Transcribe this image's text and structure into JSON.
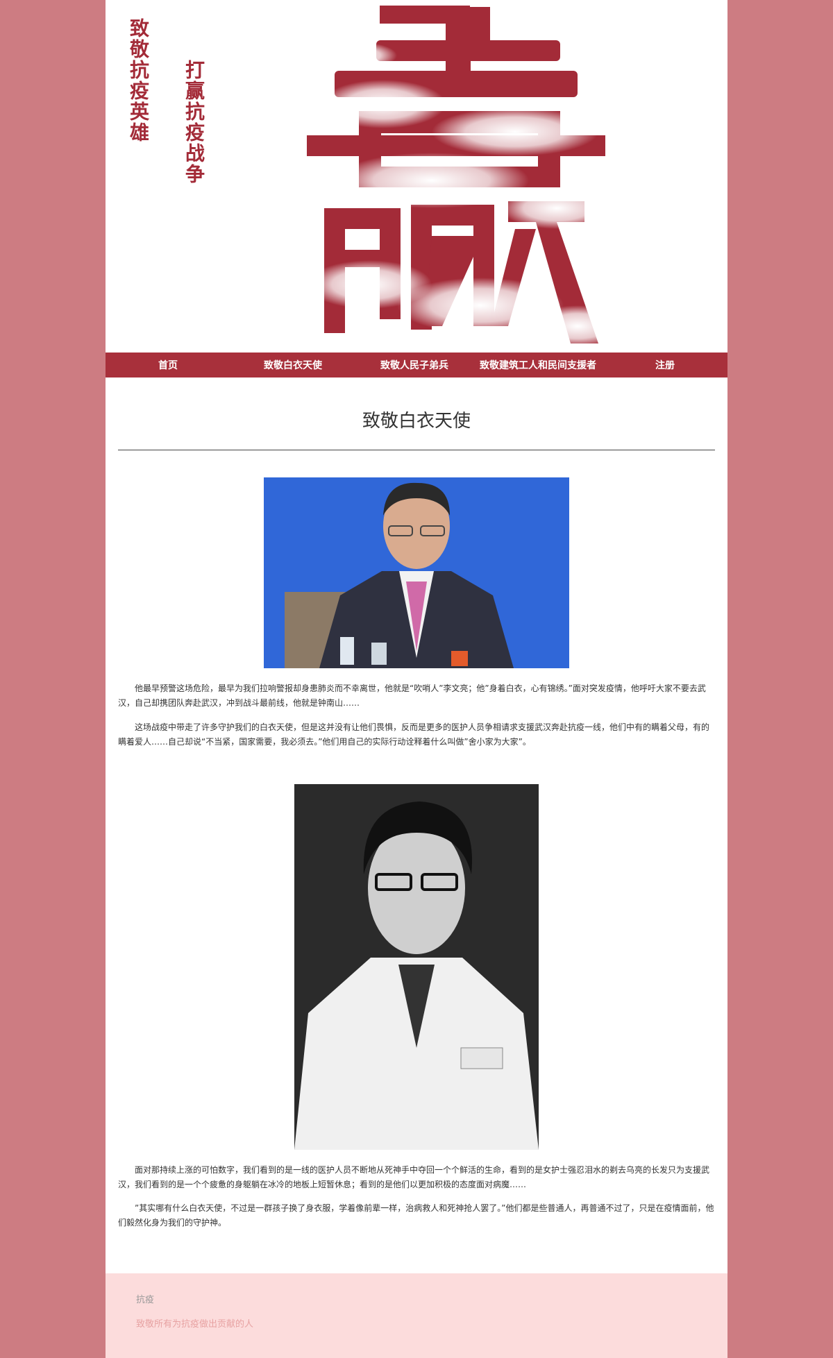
{
  "banner": {
    "left_column": [
      "致敬",
      "抗疫",
      "英雄"
    ],
    "right_column": [
      "打赢",
      "抗疫",
      "战争"
    ],
    "big_character": "赢"
  },
  "nav": {
    "items": [
      {
        "label": "首页"
      },
      {
        "label": "致敬白衣天使"
      },
      {
        "label": "致敬人民子弟兵"
      },
      {
        "label": "致敬建筑工人和民间支援者"
      },
      {
        "label": "注册"
      }
    ]
  },
  "article": {
    "title": "致敬白衣天使",
    "paragraphs": [
      "他最早预警这场危险，最早为我们拉响警报却身患肺炎而不幸离世，他就是“吹哨人”李文亮；他”身着白衣，心有锦绣。”面对突发疫情，他呼吁大家不要去武汉，自己却携团队奔赴武汉，冲到战斗最前线，他就是钟南山……",
      "这场战疫中带走了许多守护我们的白衣天使，但是这并没有让他们畏惧，反而是更多的医护人员争相请求支援武汉奔赴抗疫一线，他们中有的瞒着父母，有的瞒着爱人……自己却说“不当紧，国家需要，我必须去。”他们用自己的实际行动诠释着什么叫做”舍小家为大家”。",
      "面对那持续上涨的可怕数字，我们看到的是一线的医护人员不断地从死神手中夺回一个个鲜活的生命，看到的是女护士强忍泪水的剃去乌亮的长发只为支援武汉，我们看到的是一个个疲惫的身躯躺在冰冷的地板上短暂休息；看到的是他们以更加积极的态度面对病魔……",
      "”其实哪有什么白衣天使，不过是一群孩子换了身衣服，学着像前辈一样，治病救人和死神抢人罢了。”他们都是些普通人，再普通不过了，只是在疫情面前，他们毅然化身为我们的守护神。"
    ]
  },
  "footer": {
    "heading": "抗疫",
    "subtext": "致敬所有为抗疫做出贡献的人"
  },
  "colors": {
    "outer_background": "#cd7c82",
    "accent_red": "#a8303b",
    "footer_background": "#fcdcdc",
    "footer_subtext": "#e7a2a2"
  }
}
